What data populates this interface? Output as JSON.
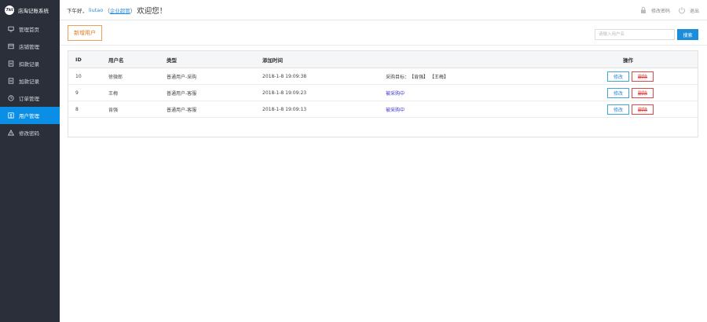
{
  "app": {
    "logo_text": "7kt",
    "title": "店淘记账系统"
  },
  "sidebar": {
    "items": [
      {
        "label": "管理首页",
        "icon": "monitor-icon",
        "active": false
      },
      {
        "label": "店铺管理",
        "icon": "store-icon",
        "active": false
      },
      {
        "label": "扣款记录",
        "icon": "document-icon",
        "active": false
      },
      {
        "label": "加款记录",
        "icon": "document-icon",
        "active": false
      },
      {
        "label": "订单管理",
        "icon": "clock-icon",
        "active": false
      },
      {
        "label": "用户管理",
        "icon": "user-icon",
        "active": true
      },
      {
        "label": "修改密码",
        "icon": "warning-icon",
        "active": false
      }
    ]
  },
  "header": {
    "greeting_prefix": "下午好，",
    "username": "liutao",
    "role_open": "（",
    "role": "企业超管",
    "role_close": "）",
    "welcome": "欢迎您！",
    "change_password": "修改密码",
    "logout": "退出"
  },
  "toolbar": {
    "add_user_label": "新增用户",
    "search_placeholder": "请输入用户名",
    "search_label": "搜索"
  },
  "table": {
    "columns": {
      "id": "ID",
      "name": "用户名",
      "type": "类型",
      "added_time": "添加时间",
      "ops": "操作"
    },
    "rows": [
      {
        "id": "10",
        "name": "徐微郎",
        "type": "普通用户-采购",
        "added_time": "2018-1-8 19:09:38",
        "note_prefix": "采购目标：",
        "note_tags": "【肯强】 【王梅】",
        "note_status": "",
        "edit": "修改",
        "delete": "删除"
      },
      {
        "id": "9",
        "name": "王梅",
        "type": "普通用户-客服",
        "added_time": "2018-1-8 19:09:23",
        "note_prefix": "",
        "note_tags": "",
        "note_status": "被采购中",
        "edit": "修改",
        "delete": "删除"
      },
      {
        "id": "8",
        "name": "肯强",
        "type": "普通用户-客服",
        "added_time": "2018-1-8 19:09:13",
        "note_prefix": "",
        "note_tags": "",
        "note_status": "被采购中",
        "edit": "修改",
        "delete": "删除"
      }
    ]
  },
  "colors": {
    "sidebar_bg": "#2b2f3a",
    "accent": "#0b8ee6",
    "add_button": "#e07b20",
    "delete": "#d43a3a",
    "status": "#3f35c9"
  }
}
